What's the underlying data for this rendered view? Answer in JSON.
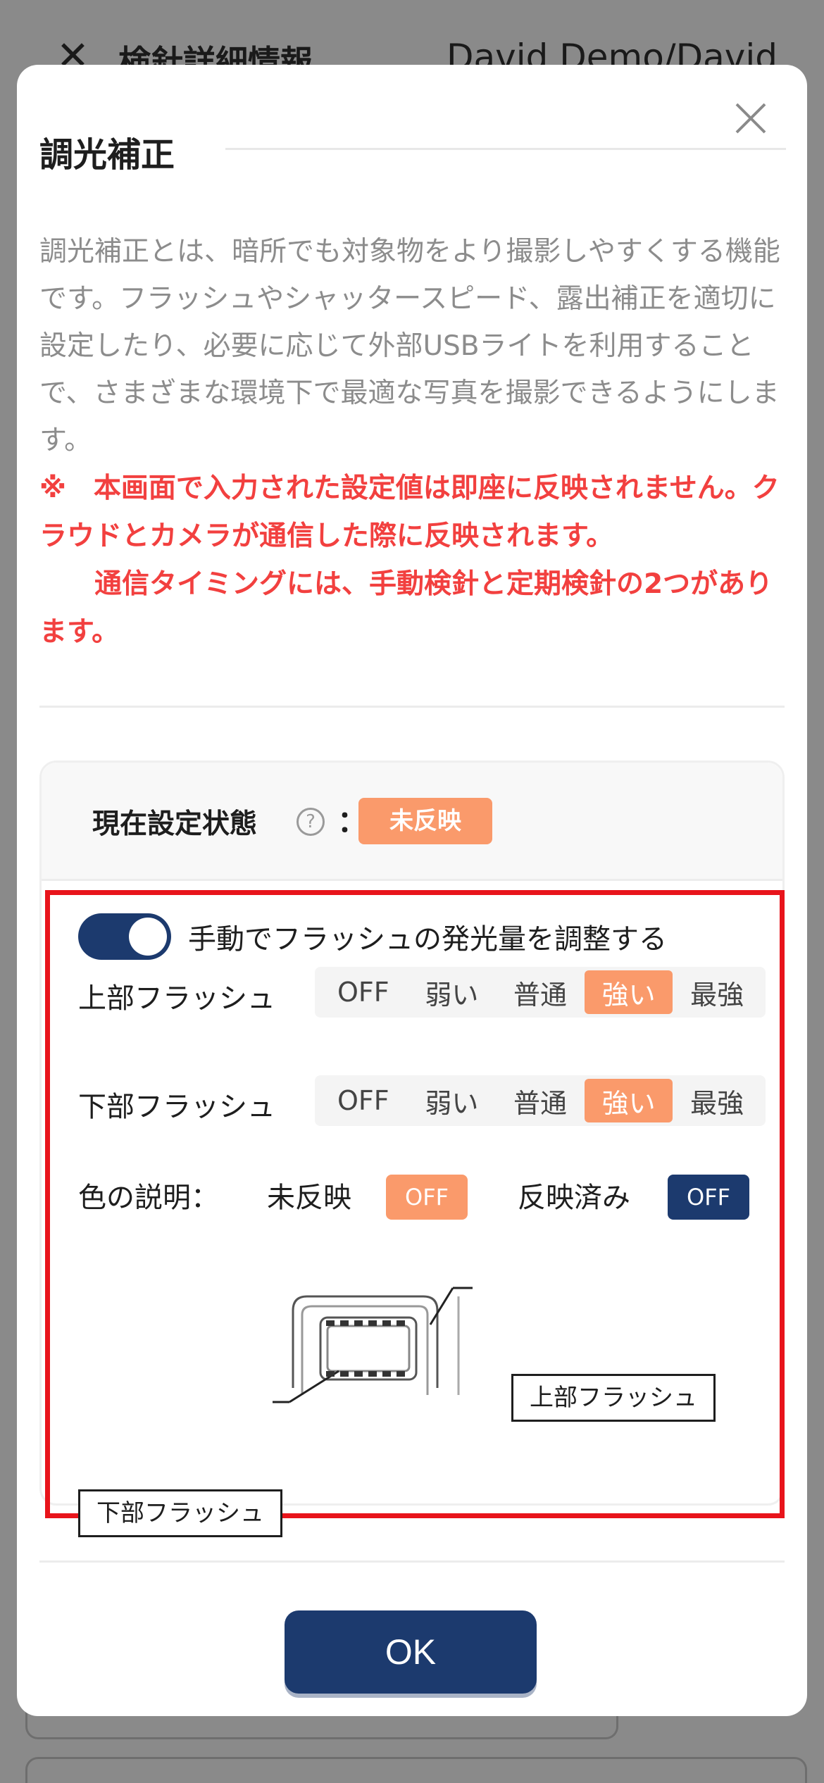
{
  "background": {
    "title": "検針詳細情報",
    "user": "David Demo/David"
  },
  "modal": {
    "title": "調光補正",
    "description": "調光補正とは、暗所でも対象物をより撮影しやすくする機能です。フラッシュやシャッタースピード、露出補正を適切に設定したり、必要に応じて外部USBライトを利用することで、さまざまな環境下で最適な写真を撮影できるようにします。",
    "notice_line1": "※　本画面で入力された設定値は即座に反映されません。クラウドとカメラが通信した際に反映されます。",
    "notice_line2": "　　通信タイミングには、手動検針と定期検針の2つがあります。",
    "status_label": "現在設定状態",
    "status_colon": "：",
    "status_value": "未反映",
    "toggle_label": "手動でフラッシュの発光量を調整する",
    "toggle_on": true,
    "upper_flash_label": "上部フラッシュ",
    "lower_flash_label": "下部フラッシュ",
    "flash_options": [
      "OFF",
      "弱い",
      "普通",
      "強い",
      "最強"
    ],
    "upper_flash_selected": "強い",
    "lower_flash_selected": "強い",
    "legend_title": "色の説明：",
    "legend_pending_label": "未反映",
    "legend_pending_badge": "OFF",
    "legend_applied_label": "反映済み",
    "legend_applied_badge": "OFF",
    "diagram_upper_label": "上部フラッシュ",
    "diagram_lower_label": "下部フラッシュ",
    "ok_label": "OK"
  },
  "colors": {
    "pending": "#fa9a6b",
    "applied": "#1c3a6e",
    "notice": "#f2403f",
    "highlight_frame": "#e8141b"
  }
}
